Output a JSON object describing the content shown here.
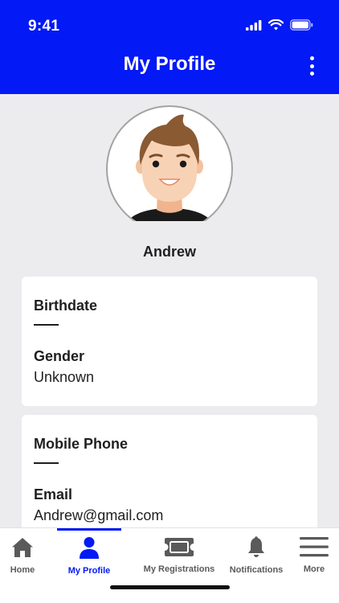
{
  "status_bar": {
    "time": "9:41"
  },
  "header": {
    "title": "My Profile"
  },
  "profile": {
    "name": "Andrew"
  },
  "card_1": {
    "birthdate_label": "Birthdate",
    "gender_label": "Gender",
    "gender_value": "Unknown"
  },
  "card_2": {
    "mobile_label": "Mobile Phone",
    "email_label": "Email",
    "email_value": "Andrew@gmail.com"
  },
  "nav": {
    "home": "Home",
    "profile": "My Profile",
    "registrations": "My Registrations",
    "notifications": "Notifications",
    "more": "More"
  },
  "colors": {
    "brand": "#0319f6",
    "background": "#ececef",
    "nav_inactive": "#5a5a5a"
  }
}
